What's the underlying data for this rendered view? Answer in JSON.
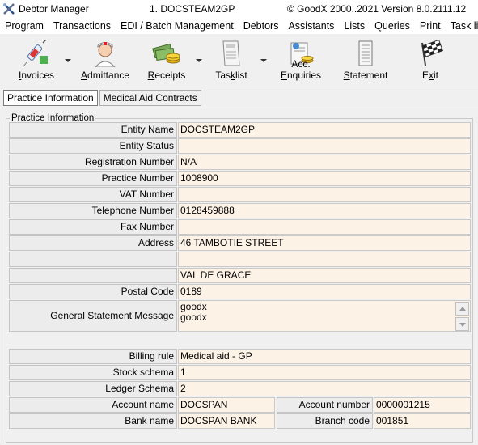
{
  "window": {
    "app_title": "Debtor Manager",
    "document": "1. DOCSTEAM2GP",
    "version": "© GoodX 2000..2021  Version 8.0.2111.12",
    "app_icon": "tools-cross-icon"
  },
  "menu": [
    "Program",
    "Transactions",
    "EDI / Batch Management",
    "Debtors",
    "Assistants",
    "Lists",
    "Queries",
    "Print",
    "Task list"
  ],
  "toolbar": {
    "invoices": {
      "pre": "",
      "accel": "I",
      "post": "nvoices",
      "icon": "syringe-icon"
    },
    "admittance": {
      "pre": "",
      "accel": "A",
      "post": "dmittance",
      "icon": "nurse-icon"
    },
    "receipts": {
      "pre": "",
      "accel": "R",
      "post": "eceipts",
      "icon": "money-icon"
    },
    "tasklist": {
      "pre": "Tas",
      "accel": "k",
      "post": "list",
      "icon": "task-paper-icon"
    },
    "acc_enquiries": {
      "pre": "Acc. ",
      "accel": "E",
      "post": "nquiries",
      "icon": "enquiry-icon"
    },
    "statement": {
      "pre": "",
      "accel": "S",
      "post": "tatement",
      "icon": "statement-icon"
    },
    "exit": {
      "pre": "E",
      "accel": "x",
      "post": "it",
      "icon": "checkered-flag-icon"
    }
  },
  "tabs": {
    "practice_info": "Practice Information",
    "medical_aid": "Medical Aid Contracts"
  },
  "group_title": "Practice Information",
  "fields": {
    "entity_name": {
      "label": "Entity Name",
      "value": "DOCSTEAM2GP"
    },
    "entity_status": {
      "label": "Entity Status",
      "value": ""
    },
    "registration_number": {
      "label": "Registration Number",
      "value": "N/A"
    },
    "practice_number": {
      "label": "Practice Number",
      "value": "1008900"
    },
    "vat_number": {
      "label": "VAT Number",
      "value": ""
    },
    "telephone_number": {
      "label": "Telephone Number",
      "value": "0128459888"
    },
    "fax_number": {
      "label": "Fax Number",
      "value": ""
    },
    "address": {
      "label": "Address",
      "value": "46 TAMBOTIE STREET"
    },
    "address_2": {
      "label": "",
      "value": ""
    },
    "address_3": {
      "label": "",
      "value": "VAL DE GRACE"
    },
    "postal_code": {
      "label": "Postal Code",
      "value": "0189"
    },
    "general_statement_message": {
      "label": "General Statement Message",
      "line1": "goodx",
      "line2": "goodx"
    },
    "billing_rule": {
      "label": "Billing rule",
      "value": "Medical aid - GP"
    },
    "stock_schema": {
      "label": "Stock schema",
      "value": "1"
    },
    "ledger_schema": {
      "label": "Ledger Schema",
      "value": "2"
    },
    "account_name": {
      "label": "Account name",
      "value": "DOCSPAN"
    },
    "account_number": {
      "label": "Account number",
      "value": "0000001215"
    },
    "bank_name": {
      "label": "Bank name",
      "value": "DOCSPAN BANK"
    },
    "branch_code": {
      "label": "Branch code",
      "value": "001851"
    }
  }
}
